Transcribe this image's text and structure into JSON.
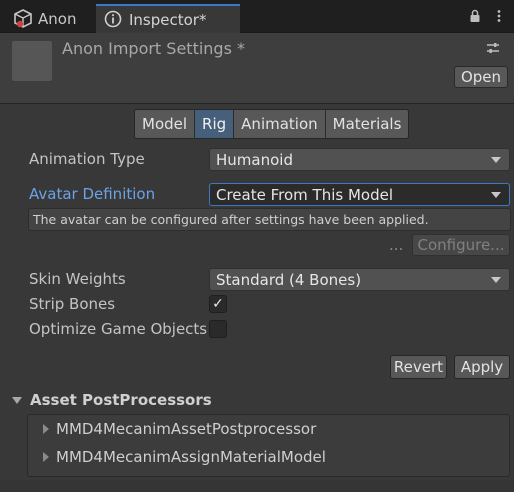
{
  "tabs": {
    "inactive_label": "Anon",
    "active_label": "Inspector*"
  },
  "header": {
    "title": "Anon Import Settings *",
    "open_label": "Open"
  },
  "segments": [
    "Model",
    "Rig",
    "Animation",
    "Materials"
  ],
  "active_segment": "Rig",
  "fields": {
    "animation_type_label": "Animation Type",
    "animation_type_value": "Humanoid",
    "avatar_definition_label": "Avatar Definition",
    "avatar_definition_value": "Create From This Model",
    "help_text": "The avatar can be configured after settings have been applied.",
    "ellipsis": "...",
    "configure_label": "Configure...",
    "skin_weights_label": "Skin Weights",
    "skin_weights_value": "Standard (4 Bones)",
    "strip_bones_label": "Strip Bones",
    "optimize_label": "Optimize Game Objects"
  },
  "checkbox_marks": {
    "strip_bones": "✓"
  },
  "buttons": {
    "revert": "Revert",
    "apply": "Apply"
  },
  "postprocessors": {
    "title": "Asset PostProcessors",
    "items": [
      "MMD4MecanimAssetPostprocessor",
      "MMD4MecanimAssignMaterialModel"
    ]
  },
  "colors": {
    "accent": "#3a78c9",
    "link": "#6ba2e8",
    "active_segment": "#46607c"
  }
}
